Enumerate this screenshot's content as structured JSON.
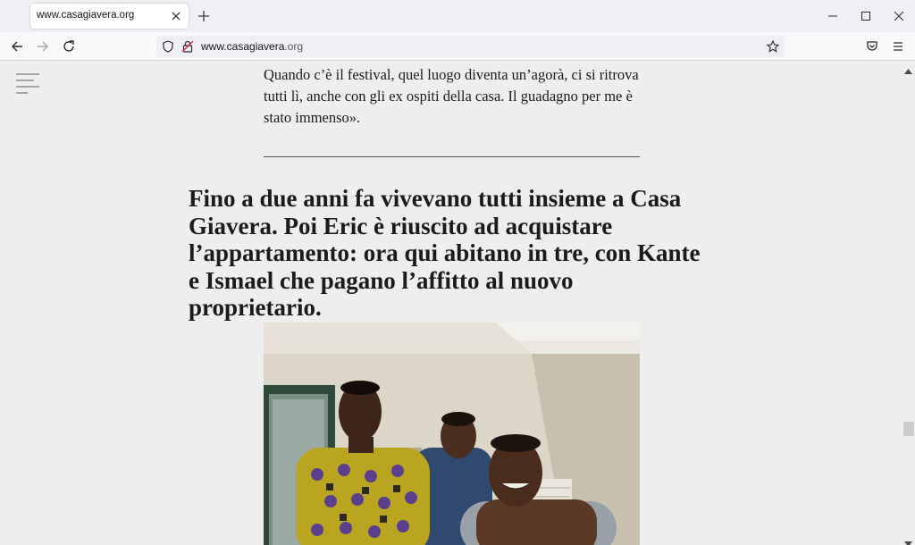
{
  "browser": {
    "tab": {
      "title": "www.casagiavera.org"
    },
    "url": {
      "domain": "www.casagiavera",
      "rest": ".org"
    }
  },
  "article": {
    "paragraph": "Quando c’è il festival, quel luogo diventa un’agorà, ci si ritrova tutti lì, anche con gli ex ospiti della casa. Il guadagno per me è stato immenso».",
    "pullquote": "Fino a due anni fa vivevano tutti insieme a Casa Giavera. Poi Eric è riuscito ad acquistare l’appartamento: ora qui abitano in tre, con Kante e Ismael che pagano l’affitto al nuovo proprietario."
  },
  "icons": {
    "tab_close": "close-icon",
    "new_tab": "plus-icon",
    "minimize": "minimize-icon",
    "maximize": "maximize-icon",
    "close_window": "close-icon",
    "back": "arrow-left-icon",
    "forward": "arrow-right-icon",
    "reload": "reload-icon",
    "tracking": "shield-icon",
    "connection": "lock-icon",
    "bookmark": "star-icon",
    "pocket": "pocket-icon",
    "menu": "hamburger-icon",
    "site_menu": "hamburger-icon"
  },
  "colors": {
    "page_background": "#efeeee",
    "text": "#1b1b1b",
    "toolbar": "#f9f9fb",
    "tabstrip": "#f0f0f4"
  }
}
